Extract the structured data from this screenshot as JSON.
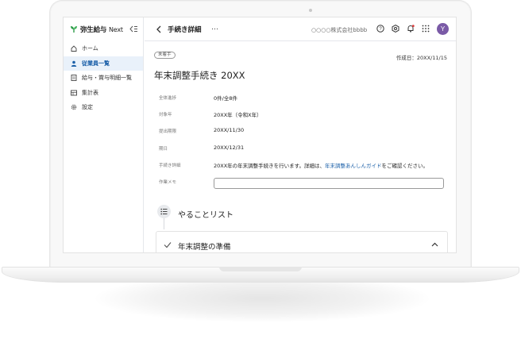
{
  "app": {
    "logo_brand": "弥生給与",
    "logo_suffix": "Next",
    "company_name": "○○○○株式会社bbbb",
    "avatar_initial": "Y"
  },
  "sidebar": {
    "items": [
      {
        "label": "ホーム",
        "icon": "home-icon",
        "active": false
      },
      {
        "label": "従業員一覧",
        "icon": "person-icon",
        "active": true
      },
      {
        "label": "給与・賞与明細一覧",
        "icon": "document-icon",
        "active": false
      },
      {
        "label": "集計表",
        "icon": "table-icon",
        "active": false
      },
      {
        "label": "設定",
        "icon": "gear-icon",
        "active": false
      }
    ]
  },
  "topbar": {
    "title": "手続き詳細",
    "more_label": "…"
  },
  "main": {
    "status_badge": "未着手",
    "created_date": "作成日：20XX/11/15",
    "heading": "年末調整手続き 20XX",
    "fields": [
      {
        "label": "全体進捗",
        "value": "0件/全8件"
      },
      {
        "label": "対象年",
        "value": "20XX年（令和X年）"
      },
      {
        "label": "提出期限",
        "value": "20XX/11/30"
      },
      {
        "label": "期日",
        "value": "20XX/12/31"
      },
      {
        "label": "手続き詳細",
        "value_before": "20XX年の年末調整手続きを行います。詳細は、",
        "value_link": "年末調整あんしんガイド",
        "value_after": "をご確認ください。"
      }
    ],
    "memo_label": "作業メモ",
    "memo_value": "",
    "todo_title": "やることリスト",
    "card_title": "年末調整の準備"
  },
  "colors": {
    "accent": "#1a5fa8",
    "active_bg": "#e9f1fa",
    "avatar": "#7a5aa6",
    "logo_green": "#2e9d4a"
  }
}
